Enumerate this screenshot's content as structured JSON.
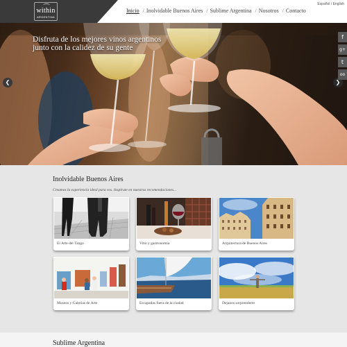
{
  "header": {
    "logo_text": "within",
    "logo_subtext": "ARGENTINA",
    "nav": [
      {
        "label": "Inicio",
        "active": true
      },
      {
        "label": "Inolvidable Buenos Aires",
        "active": false
      },
      {
        "label": "Sublime Argentina",
        "active": false
      },
      {
        "label": "Nosotros",
        "active": false
      },
      {
        "label": "Contacto",
        "active": false
      }
    ],
    "lang_es": "Español",
    "lang_sep": "/",
    "lang_en": "English"
  },
  "hero": {
    "caption": "Disfruta de los mejores vinos argentinos junto con la calidez de su gente",
    "prev_icon": "chevron-left-icon",
    "next_icon": "chevron-right-icon"
  },
  "social": [
    {
      "icon": "facebook-icon",
      "glyph": "f",
      "color": "#5a5a5a"
    },
    {
      "icon": "google-plus-icon",
      "glyph": "g+",
      "color": "#5a5a5a"
    },
    {
      "icon": "twitter-icon",
      "glyph": "t",
      "color": "#5a5a5a"
    },
    {
      "icon": "tripadvisor-icon",
      "glyph": "oo",
      "color": "#5a5a5a"
    }
  ],
  "section_buenos_aires": {
    "title": "Inolvidable Buenos Aires",
    "subtitle": "Creamos la experiencia ideal para vos. Inspirate en nuestras recomendaciones...",
    "cards": [
      {
        "label": "El Arte del Tango"
      },
      {
        "label": "Vino y gastronomía"
      },
      {
        "label": "Arquitectura de Buenos Aires"
      },
      {
        "label": "Museos y Galerías de Arte"
      },
      {
        "label": "Escapadas fuera de la ciudad"
      },
      {
        "label": "Dejanos sorprenderte"
      }
    ]
  },
  "section_argentina": {
    "title": "Sublime Argentina"
  }
}
